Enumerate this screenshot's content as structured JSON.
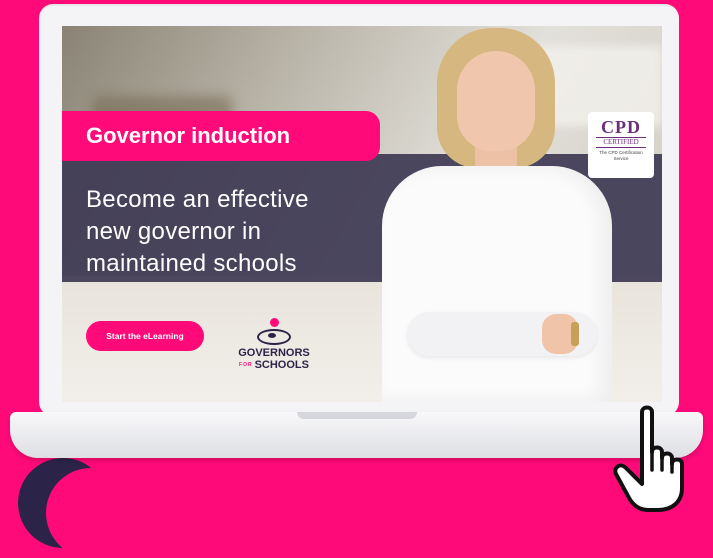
{
  "banner": {
    "title": "Governor induction",
    "subtitle_lines": [
      "Become an effective",
      "new governor in",
      "maintained schools"
    ],
    "cta_label": "Start the eLearning"
  },
  "logo": {
    "line1": "GOVERNORS",
    "for": "FOR",
    "line2": "SCHOOLS"
  },
  "cpd_badge": {
    "title": "CPD",
    "certified": "CERTIFIED",
    "service_line1": "The CPD Certification",
    "service_line2": "Service"
  },
  "colors": {
    "brand_pink": "#ff0a78",
    "navy": "#2b2448",
    "band": "#3e3a54"
  },
  "icons": [
    "hand-pointer-icon",
    "governors-for-schools-logo",
    "cpd-certified-badge"
  ]
}
